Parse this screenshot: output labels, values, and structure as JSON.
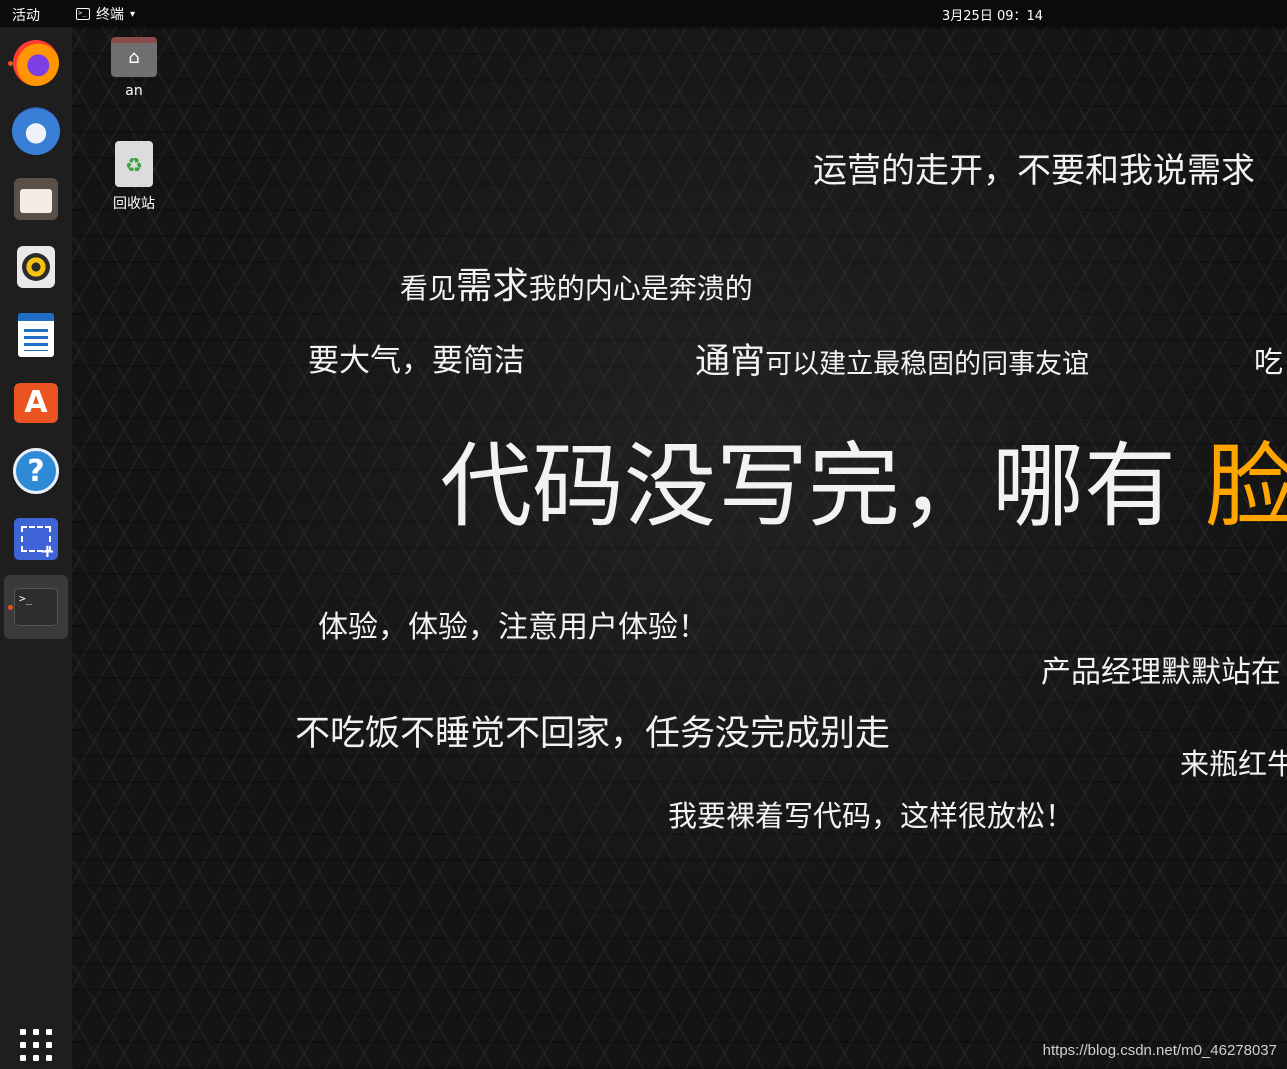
{
  "topbar": {
    "activities": "活动",
    "app_name": "终端",
    "app_icon_text": ">_",
    "caret": "▾",
    "clock": "3月25日  09：14"
  },
  "dock": {
    "items": [
      {
        "name": "firefox",
        "icon": "firefox-icon",
        "running": true
      },
      {
        "name": "thunderbird",
        "icon": "thunderbird-icon",
        "running": false
      },
      {
        "name": "files",
        "icon": "files-icon",
        "running": false
      },
      {
        "name": "rhythmbox",
        "icon": "rhythmbox-icon",
        "running": false
      },
      {
        "name": "libreoffice-writer",
        "icon": "writer-icon",
        "running": false
      },
      {
        "name": "ubuntu-software",
        "icon": "software-icon",
        "running": false
      },
      {
        "name": "help",
        "icon": "help-icon",
        "running": false
      },
      {
        "name": "screenshot",
        "icon": "screenshot-icon",
        "running": false
      },
      {
        "name": "terminal",
        "icon": "terminal-icon",
        "running": true,
        "active": true
      }
    ],
    "help_glyph": "?",
    "software_glyph": "A",
    "terminal_glyph": ">_"
  },
  "desktop": {
    "home_label": "an",
    "trash_label": "回收站",
    "phrases": {
      "p1": "运营的走开，不要和我说需求",
      "p2_pre": "看见",
      "p2_big": "需求",
      "p2_post": "我的内心是奔溃的",
      "p3": "要大气，要简洁",
      "p4_big": "通宵",
      "p4_post": "可以建立最稳固的同事友谊",
      "p5": "吃",
      "p6_main": "代码没写完，哪有 ",
      "p6_accent": "脸",
      "p7": "体验，体验，注意用户体验！",
      "p8": "产品经理默默站在",
      "p9": "不吃饭不睡觉不回家，任务没完成别走",
      "p10": "来瓶红牛",
      "p11": "我要裸着写代码，这样很放松！"
    },
    "accent_color": "#ffa500",
    "watermark": "https://blog.csdn.net/m0_46278037"
  }
}
